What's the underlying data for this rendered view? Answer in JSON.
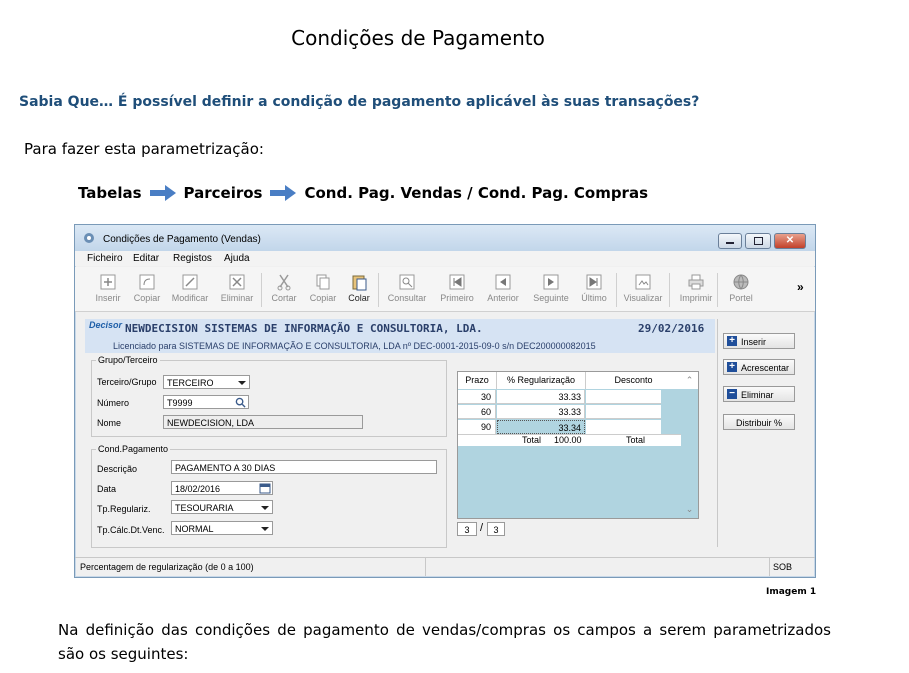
{
  "doc": {
    "title": "Condições de Pagamento",
    "tip": "Sabia Que… É possível definir a condição de pagamento aplicável às suas transações?",
    "intro": "Para fazer esta parametrização:",
    "path": [
      "Tabelas",
      "Parceiros",
      "Cond. Pag. Vendas / Cond. Pag. Compras"
    ],
    "caption": "Imagem 1",
    "paragraph": "Na definição das condições de pagamento de vendas/compras os campos a serem parametrizados são os seguintes:"
  },
  "window": {
    "title": "Condições de Pagamento (Vendas)",
    "menu": [
      "Ficheiro",
      "Editar",
      "Registos",
      "Ajuda"
    ],
    "toolbar": [
      {
        "label": "Inserir",
        "icon": "insert-icon"
      },
      {
        "label": "Copiar",
        "icon": "copy-record-icon"
      },
      {
        "label": "Modificar",
        "icon": "edit-icon"
      },
      {
        "label": "Eliminar",
        "icon": "delete-icon"
      },
      {
        "label": "Cortar",
        "icon": "cut-icon"
      },
      {
        "label": "Copiar",
        "icon": "copy-icon"
      },
      {
        "label": "Colar",
        "icon": "paste-icon"
      },
      {
        "label": "Consultar",
        "icon": "search-icon"
      },
      {
        "label": "Primeiro",
        "icon": "first-icon"
      },
      {
        "label": "Anterior",
        "icon": "previous-icon"
      },
      {
        "label": "Seguinte",
        "icon": "next-icon"
      },
      {
        "label": "Último",
        "icon": "last-icon"
      },
      {
        "label": "Visualizar",
        "icon": "preview-icon"
      },
      {
        "label": "Imprimir",
        "icon": "print-icon"
      },
      {
        "label": "Portel",
        "icon": "globe-icon"
      }
    ],
    "toolbar_more": "»",
    "company": {
      "logo": "Decisor",
      "name": "NEWDECISION SISTEMAS DE INFORMAÇÃO E CONSULTORIA, LDA.",
      "date": "29/02/2016",
      "license": "Licenciado para  SISTEMAS DE INFORMAÇÃO E CONSULTORIA, LDA nº DEC-0001-2015-09-0 s/n DEC200000082015"
    },
    "grupo": {
      "legend": "Grupo/Terceiro",
      "tipo_label": "Terceiro/Grupo",
      "tipo_value": "TERCEIRO",
      "numero_label": "Número",
      "numero_value": "T9999",
      "nome_label": "Nome",
      "nome_value": "NEWDECISION, LDA"
    },
    "cond": {
      "legend": "Cond.Pagamento",
      "descricao_label": "Descrição",
      "descricao_value": "PAGAMENTO A 30 DIAS",
      "data_label": "Data",
      "data_value": "18/02/2016",
      "tpreg_label": "Tp.Regulariz.",
      "tpreg_value": "TESOURARIA",
      "tpcalc_label": "Tp.Cálc.Dt.Venc.",
      "tpcalc_value": "NORMAL"
    },
    "grid": {
      "headers": [
        "Prazo",
        "% Regularização",
        "Desconto"
      ],
      "rows": [
        {
          "prazo": "30",
          "pct": "33.33"
        },
        {
          "prazo": "60",
          "pct": "33.33"
        },
        {
          "prazo": "90",
          "pct": "33.34"
        }
      ],
      "total_label": "Total",
      "total_value": "100.00",
      "total_label2": "Total",
      "page_current": "3",
      "page_sep": "/",
      "page_total": "3"
    },
    "buttons": {
      "inserir": "Inserir",
      "acrescentar": "Acrescentar",
      "eliminar": "Eliminar",
      "distribuir": "Distribuir %"
    },
    "status": {
      "text": "Percentagem de regularização (de 0 a 100)",
      "mode": "SOB"
    }
  }
}
